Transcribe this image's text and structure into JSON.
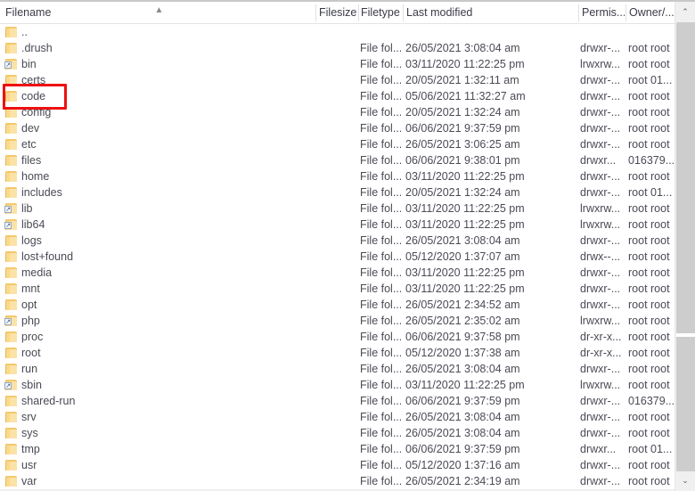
{
  "window": {
    "kind": "file-manager-remote-listing",
    "sort_column": "Filename",
    "sort_direction": "ascending",
    "highlight_color": "#ee1111",
    "highlighted_row": "code"
  },
  "columns": [
    {
      "key": "name",
      "label": "Filename"
    },
    {
      "key": "size",
      "label": "Filesize"
    },
    {
      "key": "type",
      "label": "Filetype"
    },
    {
      "key": "mod",
      "label": "Last modified"
    },
    {
      "key": "perm",
      "label": "Permis..."
    },
    {
      "key": "owner",
      "label": "Owner/..."
    }
  ],
  "scrollbar": {
    "up_arrow": "⌃",
    "down_arrow": "⌄"
  },
  "icons": {
    "folder": "folder-icon",
    "symlink": "folder-shortcut-icon",
    "shortcut_arrow": "↗"
  },
  "rows": [
    {
      "name": "..",
      "icon": "folder",
      "size": "",
      "type": "",
      "mod": "",
      "perm": "",
      "owner": ""
    },
    {
      "name": ".drush",
      "icon": "folder",
      "size": "",
      "type": "File fol...",
      "mod": "26/05/2021 3:08:04 am",
      "perm": "drwxr-...",
      "owner": "root root"
    },
    {
      "name": "bin",
      "icon": "symlink",
      "size": "",
      "type": "File fol...",
      "mod": "03/11/2020 11:22:25 pm",
      "perm": "lrwxrw...",
      "owner": "root root"
    },
    {
      "name": "certs",
      "icon": "folder",
      "size": "",
      "type": "File fol...",
      "mod": "20/05/2021 1:32:11 am",
      "perm": "drwxr-...",
      "owner": "root 01..."
    },
    {
      "name": "code",
      "icon": "folder",
      "size": "",
      "type": "File fol...",
      "mod": "05/06/2021 11:32:27 am",
      "perm": "drwxr-...",
      "owner": "root root"
    },
    {
      "name": "config",
      "icon": "folder",
      "size": "",
      "type": "File fol...",
      "mod": "20/05/2021 1:32:24 am",
      "perm": "drwxr-...",
      "owner": "root root"
    },
    {
      "name": "dev",
      "icon": "folder",
      "size": "",
      "type": "File fol...",
      "mod": "06/06/2021 9:37:59 pm",
      "perm": "drwxr-...",
      "owner": "root root"
    },
    {
      "name": "etc",
      "icon": "folder",
      "size": "",
      "type": "File fol...",
      "mod": "26/05/2021 3:06:25 am",
      "perm": "drwxr-...",
      "owner": "root root"
    },
    {
      "name": "files",
      "icon": "folder",
      "size": "",
      "type": "File fol...",
      "mod": "06/06/2021 9:38:01 pm",
      "perm": "drwxr...",
      "owner": "016379..."
    },
    {
      "name": "home",
      "icon": "folder",
      "size": "",
      "type": "File fol...",
      "mod": "03/11/2020 11:22:25 pm",
      "perm": "drwxr-...",
      "owner": "root root"
    },
    {
      "name": "includes",
      "icon": "folder",
      "size": "",
      "type": "File fol...",
      "mod": "20/05/2021 1:32:24 am",
      "perm": "drwxr-...",
      "owner": "root 01..."
    },
    {
      "name": "lib",
      "icon": "symlink",
      "size": "",
      "type": "File fol...",
      "mod": "03/11/2020 11:22:25 pm",
      "perm": "lrwxrw...",
      "owner": "root root"
    },
    {
      "name": "lib64",
      "icon": "symlink",
      "size": "",
      "type": "File fol...",
      "mod": "03/11/2020 11:22:25 pm",
      "perm": "lrwxrw...",
      "owner": "root root"
    },
    {
      "name": "logs",
      "icon": "folder",
      "size": "",
      "type": "File fol...",
      "mod": "26/05/2021 3:08:04 am",
      "perm": "drwxr-...",
      "owner": "root root"
    },
    {
      "name": "lost+found",
      "icon": "folder",
      "size": "",
      "type": "File fol...",
      "mod": "05/12/2020 1:37:07 am",
      "perm": "drwx--...",
      "owner": "root root"
    },
    {
      "name": "media",
      "icon": "folder",
      "size": "",
      "type": "File fol...",
      "mod": "03/11/2020 11:22:25 pm",
      "perm": "drwxr-...",
      "owner": "root root"
    },
    {
      "name": "mnt",
      "icon": "folder",
      "size": "",
      "type": "File fol...",
      "mod": "03/11/2020 11:22:25 pm",
      "perm": "drwxr-...",
      "owner": "root root"
    },
    {
      "name": "opt",
      "icon": "folder",
      "size": "",
      "type": "File fol...",
      "mod": "26/05/2021 2:34:52 am",
      "perm": "drwxr-...",
      "owner": "root root"
    },
    {
      "name": "php",
      "icon": "symlink",
      "size": "",
      "type": "File fol...",
      "mod": "26/05/2021 2:35:02 am",
      "perm": "lrwxrw...",
      "owner": "root root"
    },
    {
      "name": "proc",
      "icon": "folder",
      "size": "",
      "type": "File fol...",
      "mod": "06/06/2021 9:37:58 pm",
      "perm": "dr-xr-x...",
      "owner": "root root"
    },
    {
      "name": "root",
      "icon": "folder",
      "size": "",
      "type": "File fol...",
      "mod": "05/12/2020 1:37:38 am",
      "perm": "dr-xr-x...",
      "owner": "root root"
    },
    {
      "name": "run",
      "icon": "folder",
      "size": "",
      "type": "File fol...",
      "mod": "26/05/2021 3:08:04 am",
      "perm": "drwxr-...",
      "owner": "root root"
    },
    {
      "name": "sbin",
      "icon": "symlink",
      "size": "",
      "type": "File fol...",
      "mod": "03/11/2020 11:22:25 pm",
      "perm": "lrwxrw...",
      "owner": "root root"
    },
    {
      "name": "shared-run",
      "icon": "folder",
      "size": "",
      "type": "File fol...",
      "mod": "06/06/2021 9:37:59 pm",
      "perm": "drwxr-...",
      "owner": "016379..."
    },
    {
      "name": "srv",
      "icon": "folder",
      "size": "",
      "type": "File fol...",
      "mod": "26/05/2021 3:08:04 am",
      "perm": "drwxr-...",
      "owner": "root root"
    },
    {
      "name": "sys",
      "icon": "folder",
      "size": "",
      "type": "File fol...",
      "mod": "26/05/2021 3:08:04 am",
      "perm": "drwxr-...",
      "owner": "root root"
    },
    {
      "name": "tmp",
      "icon": "folder",
      "size": "",
      "type": "File fol...",
      "mod": "06/06/2021 9:37:59 pm",
      "perm": "drwxr...",
      "owner": "root 01..."
    },
    {
      "name": "usr",
      "icon": "folder",
      "size": "",
      "type": "File fol...",
      "mod": "05/12/2020 1:37:16 am",
      "perm": "drwxr-...",
      "owner": "root root"
    },
    {
      "name": "var",
      "icon": "folder",
      "size": "",
      "type": "File fol...",
      "mod": "26/05/2021 2:34:19 am",
      "perm": "drwxr-...",
      "owner": "root root"
    }
  ]
}
